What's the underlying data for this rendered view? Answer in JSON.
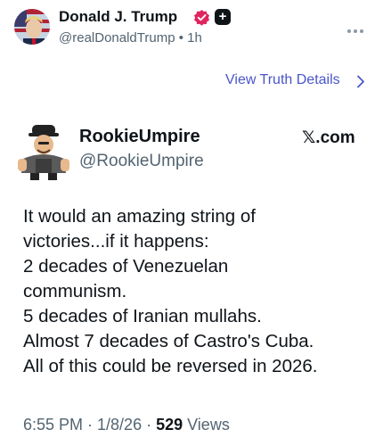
{
  "header": {
    "display_name": "Donald J. Trump",
    "handle_line": "@realDonaldTrump • 1h",
    "plus_badge": "+"
  },
  "details_link": {
    "label": "View Truth Details",
    "chevron": "›"
  },
  "embed": {
    "name": "RookieUmpire",
    "handle": "@RookieUmpire",
    "source": "𝕏.com",
    "body_lines": [
      "It would an amazing string of",
      "victories...if it happens:",
      "2 decades of Venezuelan",
      "communism.",
      "5 decades of Iranian mullahs.",
      "Almost 7 decades of Castro's Cuba.",
      "All of this could be reversed in 2026."
    ],
    "timestamp": "6:55 PM · 1/8/26 · ",
    "views_count": "529",
    "views_label": " Views"
  },
  "colors": {
    "link": "#4a55c9",
    "verified": "#e0245e",
    "muted": "#536471"
  },
  "icons": [
    "avatar",
    "verified-badge-icon",
    "plus-badge-icon",
    "more-dots-icon",
    "chevron-right-icon"
  ]
}
